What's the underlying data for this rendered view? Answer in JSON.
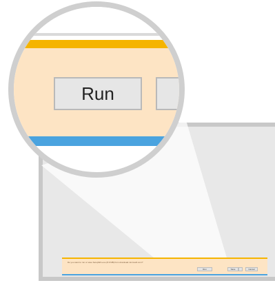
{
  "notification": {
    "message": "Do you want to run or save SetupWin.exe (8.9 MB) from download.microsoft.com?",
    "run_label": "Run",
    "save_label": "Save",
    "cancel_label": "Cancel"
  },
  "magnified": {
    "run_label": "Run"
  },
  "colors": {
    "accent_orange": "#f5b400",
    "notification_bg": "#fde4c4",
    "accent_blue": "#4aa3df"
  }
}
